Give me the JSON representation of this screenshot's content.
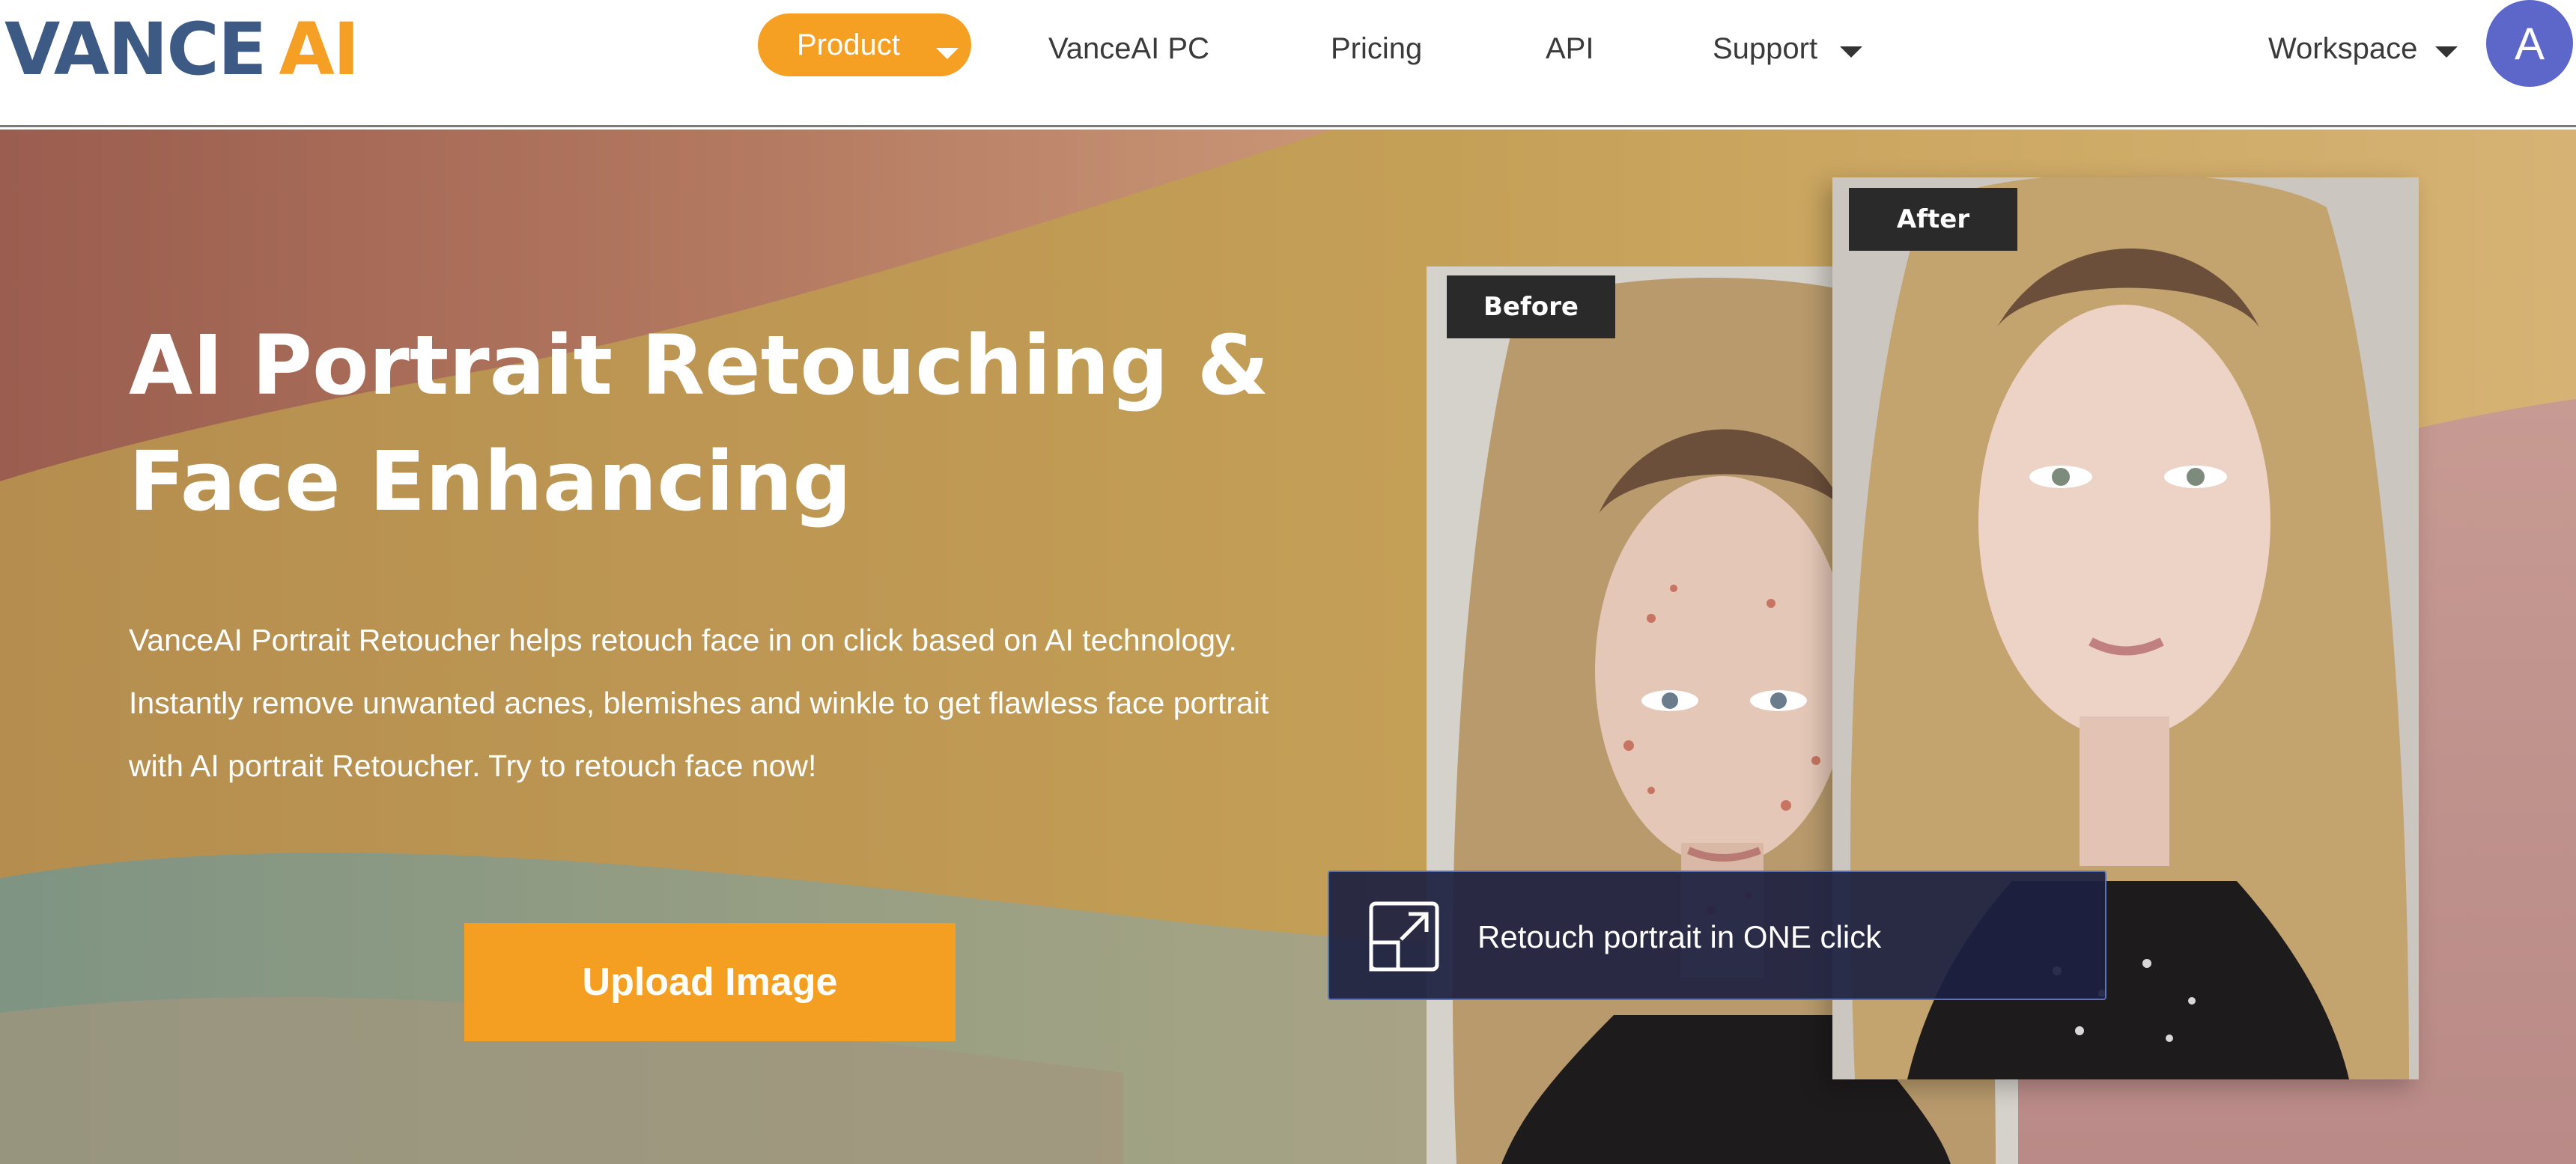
{
  "logo": {
    "part1": "VANCE",
    "part2": "AI"
  },
  "nav": {
    "product": "Product",
    "pc": "VanceAI PC",
    "pricing": "Pricing",
    "api": "API",
    "support": "Support",
    "workspace": "Workspace",
    "avatar_letter": "A"
  },
  "hero": {
    "title_line1": "AI Portrait Retouching &",
    "title_line2": "Face Enhancing",
    "desc_line1": "VanceAI Portrait Retoucher helps retouch face in on click based on AI technology.",
    "desc_line2": "Instantly remove unwanted acnes, blemishes and winkle to get flawless face portrait",
    "desc_line3": "with AI portrait Retoucher. Try to retouch face now!",
    "upload_label": "Upload Image"
  },
  "compare": {
    "before_label": "Before",
    "after_label": "After",
    "banner_text": "Retouch portrait in ONE click"
  },
  "icons": {
    "dropdown": "chevron-down-icon",
    "expand": "expand-arrow-icon"
  },
  "colors": {
    "brand_blue": "#3d5a85",
    "brand_orange": "#f59f24",
    "avatar": "#5c67c9",
    "tag_bg": "#2a2a2a",
    "banner_bg": "#1c2040"
  }
}
